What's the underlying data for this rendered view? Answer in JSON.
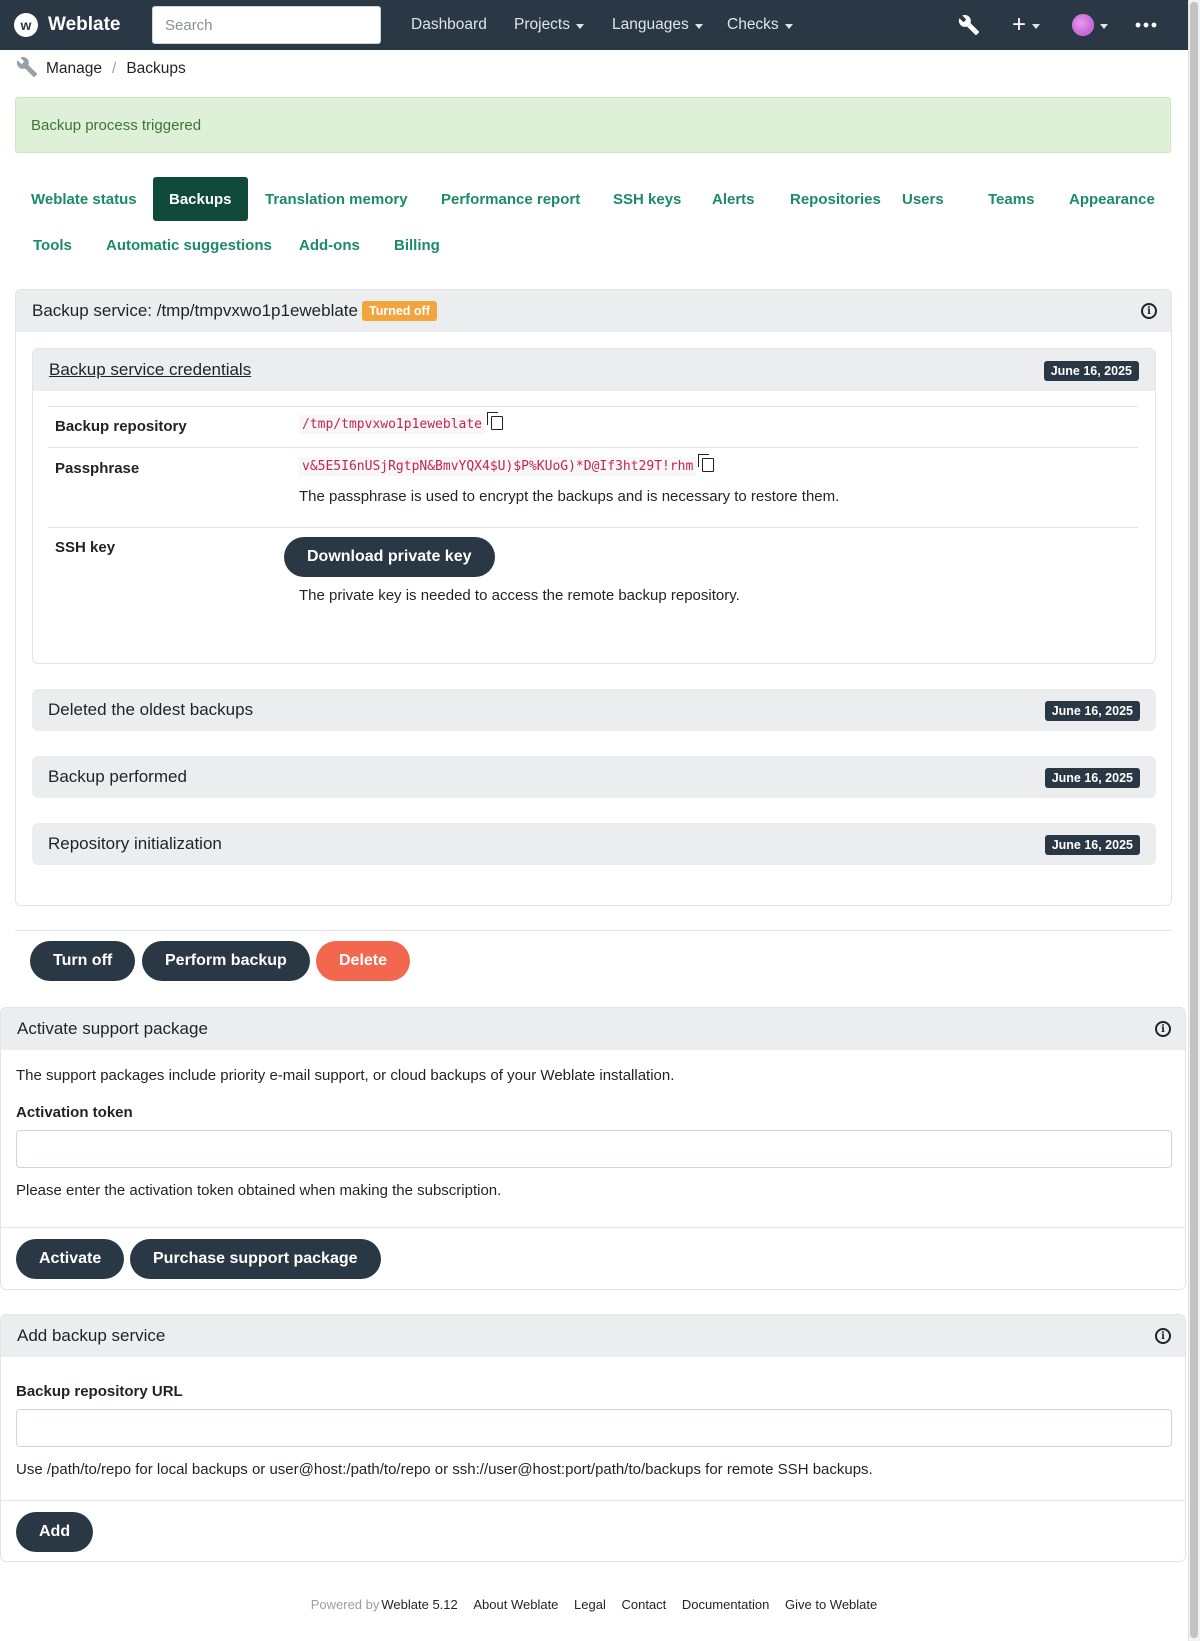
{
  "navbar": {
    "brand": "Weblate",
    "search_placeholder": "Search",
    "items": [
      "Dashboard",
      "Projects",
      "Languages",
      "Checks"
    ]
  },
  "icons": [
    "wrench-icon",
    "plus-icon",
    "avatar-icon",
    "more-icon",
    "copy-icon",
    "info-icon"
  ],
  "breadcrumb": [
    "Manage",
    "Backups"
  ],
  "alert": "Backup process triggered",
  "tabs": {
    "row1": [
      "Weblate status",
      "Backups",
      "Translation memory",
      "Performance report",
      "SSH keys",
      "Alerts",
      "Repositories",
      "Users",
      "Teams",
      "Appearance"
    ],
    "row2": [
      "Tools",
      "Automatic suggestions",
      "Add-ons",
      "Billing"
    ],
    "active": "Backups"
  },
  "backup_service": {
    "title": "Backup service: /tmp/tmpvxwo1p1eweblate",
    "status_badge": "Turned off",
    "credentials": {
      "title": "Backup service credentials",
      "date": "June 16, 2025",
      "repository_label": "Backup repository",
      "repository_value": "/tmp/tmpvxwo1p1eweblate",
      "passphrase_label": "Passphrase",
      "passphrase_value": "v&5E5I6nUSjRgtpN&BmvYQX4$U)$P%KUoG)*D@If3ht29T!rhm",
      "passphrase_help": "The passphrase is used to encrypt the backups and is necessary to restore them.",
      "ssh_label": "SSH key",
      "ssh_button": "Download private key",
      "ssh_help": "The private key is needed to access the remote backup repository."
    },
    "log": [
      {
        "title": "Deleted the oldest backups",
        "date": "June 16, 2025"
      },
      {
        "title": "Backup performed",
        "date": "June 16, 2025"
      },
      {
        "title": "Repository initialization",
        "date": "June 16, 2025"
      }
    ],
    "actions": [
      "Turn off",
      "Perform backup",
      "Delete"
    ]
  },
  "support": {
    "title": "Activate support package",
    "description": "The support packages include priority e-mail support, or cloud backups of your Weblate installation.",
    "token_label": "Activation token",
    "token_help": "Please enter the activation token obtained when making the subscription.",
    "activate_button": "Activate",
    "purchase_button": "Purchase support package"
  },
  "add_backup": {
    "title": "Add backup service",
    "url_label": "Backup repository URL",
    "url_help": "Use /path/to/repo for local backups or user@host:/path/to/repo or ssh://user@host:port/path/to/backups for remote SSH backups.",
    "add_button": "Add"
  },
  "footer": {
    "powered_by": "Powered by",
    "version": "Weblate 5.12",
    "links": [
      "About Weblate",
      "Legal",
      "Contact",
      "Documentation",
      "Give to Weblate"
    ]
  },
  "colors": {
    "navbar": "#2a3744",
    "accent": "#1d8a6a",
    "active_tab": "#0f4a3b",
    "success_bg": "#dff0d8",
    "warning": "#f2a53c",
    "danger": "#f4674f"
  }
}
